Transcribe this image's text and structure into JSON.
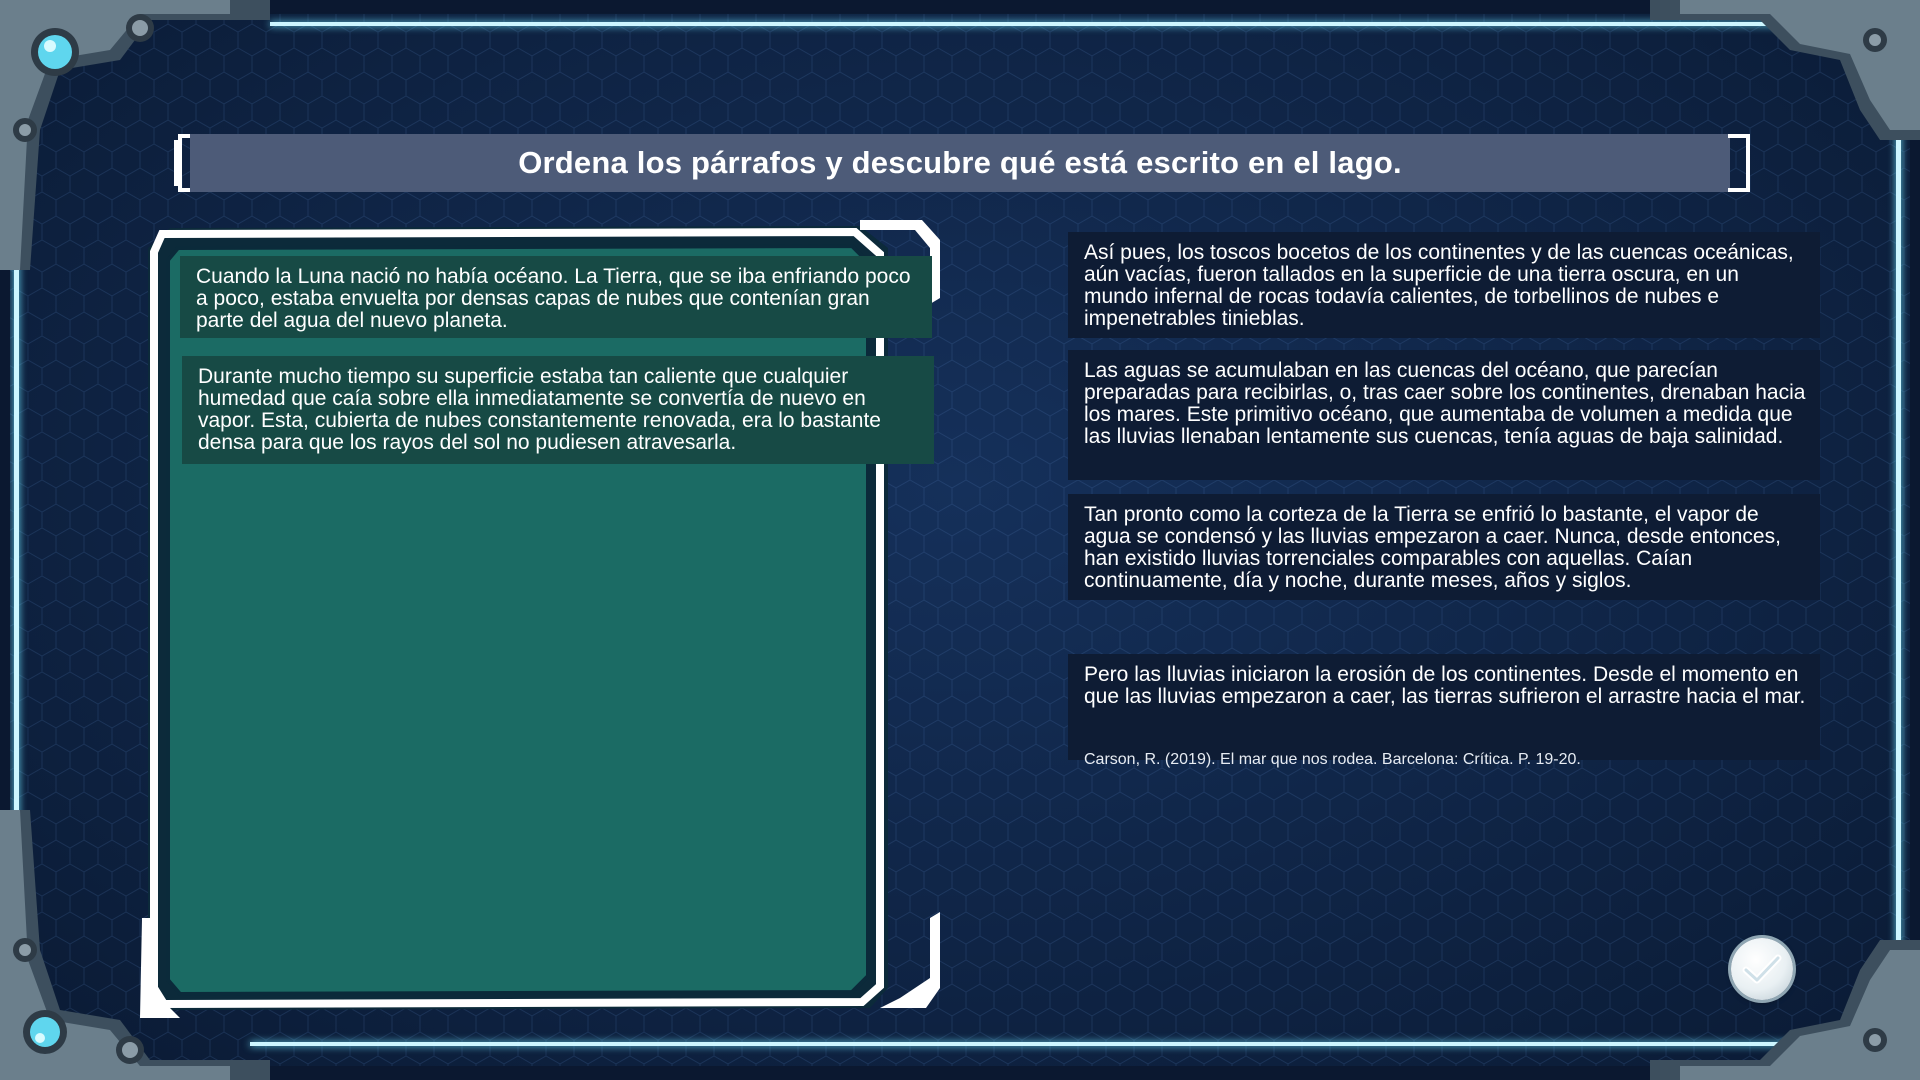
{
  "title": "Ordena los párrafos y descubre qué está escrito en el lago.",
  "placed_paragraphs": [
    "Cuando la Luna nació no había océano. La Tierra, que se iba enfriando poco a poco, estaba envuelta por densas capas de nubes que contenían gran parte del agua del nuevo planeta.",
    "Durante mucho tiempo su superficie estaba tan caliente que cualquier humedad que caía sobre ella inmediatamente se convertía de nuevo en vapor. Esta, cubierta de nubes constantemente renovada, era lo bastante densa para que los rayos del sol no pudiesen atravesarla."
  ],
  "bank_paragraphs": [
    "Así pues, los toscos bocetos de los continentes y de las cuencas oceánicas, aún vacías, fueron tallados en la superficie de una tierra oscura, en un mundo infernal de rocas todavía calientes, de torbellinos de nubes e impenetrables tinieblas.",
    "Las aguas se acumulaban en las cuencas del océano, que parecían preparadas para recibirlas, o, tras caer sobre los continentes, drenaban hacia los mares. Este primitivo océano, que aumentaba de volumen a medida que las lluvias llenaban lentamente sus cuencas, tenía aguas de baja salinidad.",
    "Tan pronto como la corteza de la Tierra se enfrió lo bastante, el vapor de agua se condensó y las lluvias empezaron a caer. Nunca, desde entonces, han existido lluvias torrenciales comparables con aquellas. Caían continuamente, día y noche, durante meses, años y siglos.",
    "Pero las lluvias iniciaron la erosión de los continentes. Desde el momento en que las lluvias empezaron a caer, las tierras sufrieron el arrastre hacia el mar."
  ],
  "citation": "Carson, R. (2019). El mar que nos rodea. Barcelona: Crítica. P. 19-20.",
  "icons": {
    "check_button": "checkmark-icon",
    "corners": "mechanical-corner-icon"
  },
  "colors": {
    "background": "#0f2445",
    "title_bar": "#4d5b78",
    "drop_zone": "#1b6b64",
    "placed_card": "#174a45",
    "bank_card": "#0e1c34",
    "frame_glow": "#cdf6ff"
  }
}
